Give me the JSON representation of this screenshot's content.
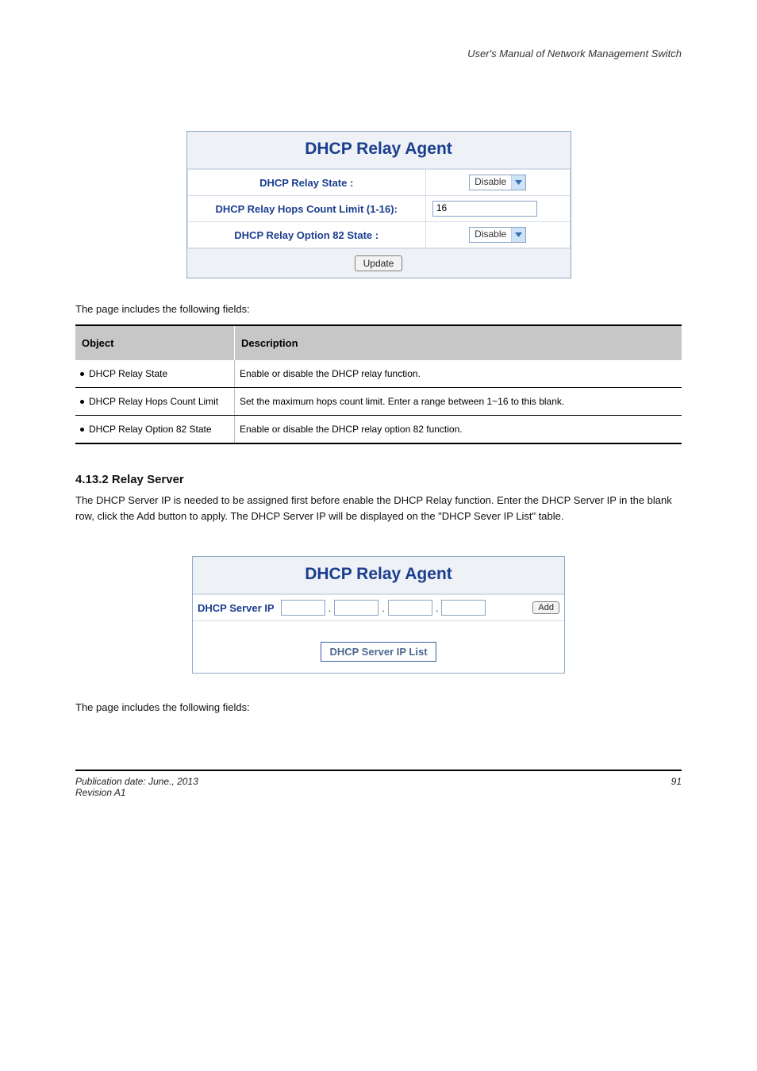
{
  "header": {
    "right": "User's Manual of Network Management Switch"
  },
  "panel1": {
    "title": "DHCP Relay Agent",
    "rows": {
      "relay_state_label": "DHCP Relay State :",
      "relay_state_value": "Disable",
      "hops_label": "DHCP Relay Hops Count Limit (1-16):",
      "hops_value": "16",
      "opt82_label": "DHCP Relay Option 82 State :",
      "opt82_value": "Disable"
    },
    "update_label": "Update"
  },
  "desc1": "The page includes the following fields:",
  "param_table": {
    "head_left": "Object",
    "head_right": "Description",
    "rows": [
      {
        "left": "DHCP Relay State",
        "right": "Enable or disable the DHCP relay function."
      },
      {
        "left": "DHCP Relay Hops Count Limit",
        "right": "Set the maximum hops count limit. Enter a range between 1~16 to this blank."
      },
      {
        "left": "DHCP Relay Option 82 State",
        "right": "Enable or disable the DHCP relay option 82 function."
      }
    ]
  },
  "section2": {
    "heading": "4.13.2 Relay Server",
    "body": "The DHCP Server IP is needed to be assigned first before enable the DHCP Relay function. Enter the DHCP Server IP in the blank row, click the Add button to apply. The DHCP Server IP will be displayed on the \"DHCP Sever IP List\" table."
  },
  "panel2": {
    "title": "DHCP Relay Agent",
    "ip_label": "DHCP Server IP",
    "add_label": "Add",
    "list_label": "DHCP Server IP List"
  },
  "desc2": "The page includes the following fields:",
  "footer": {
    "left": "Publication date: June., 2013",
    "right": "91",
    "revision": "Revision A1"
  }
}
